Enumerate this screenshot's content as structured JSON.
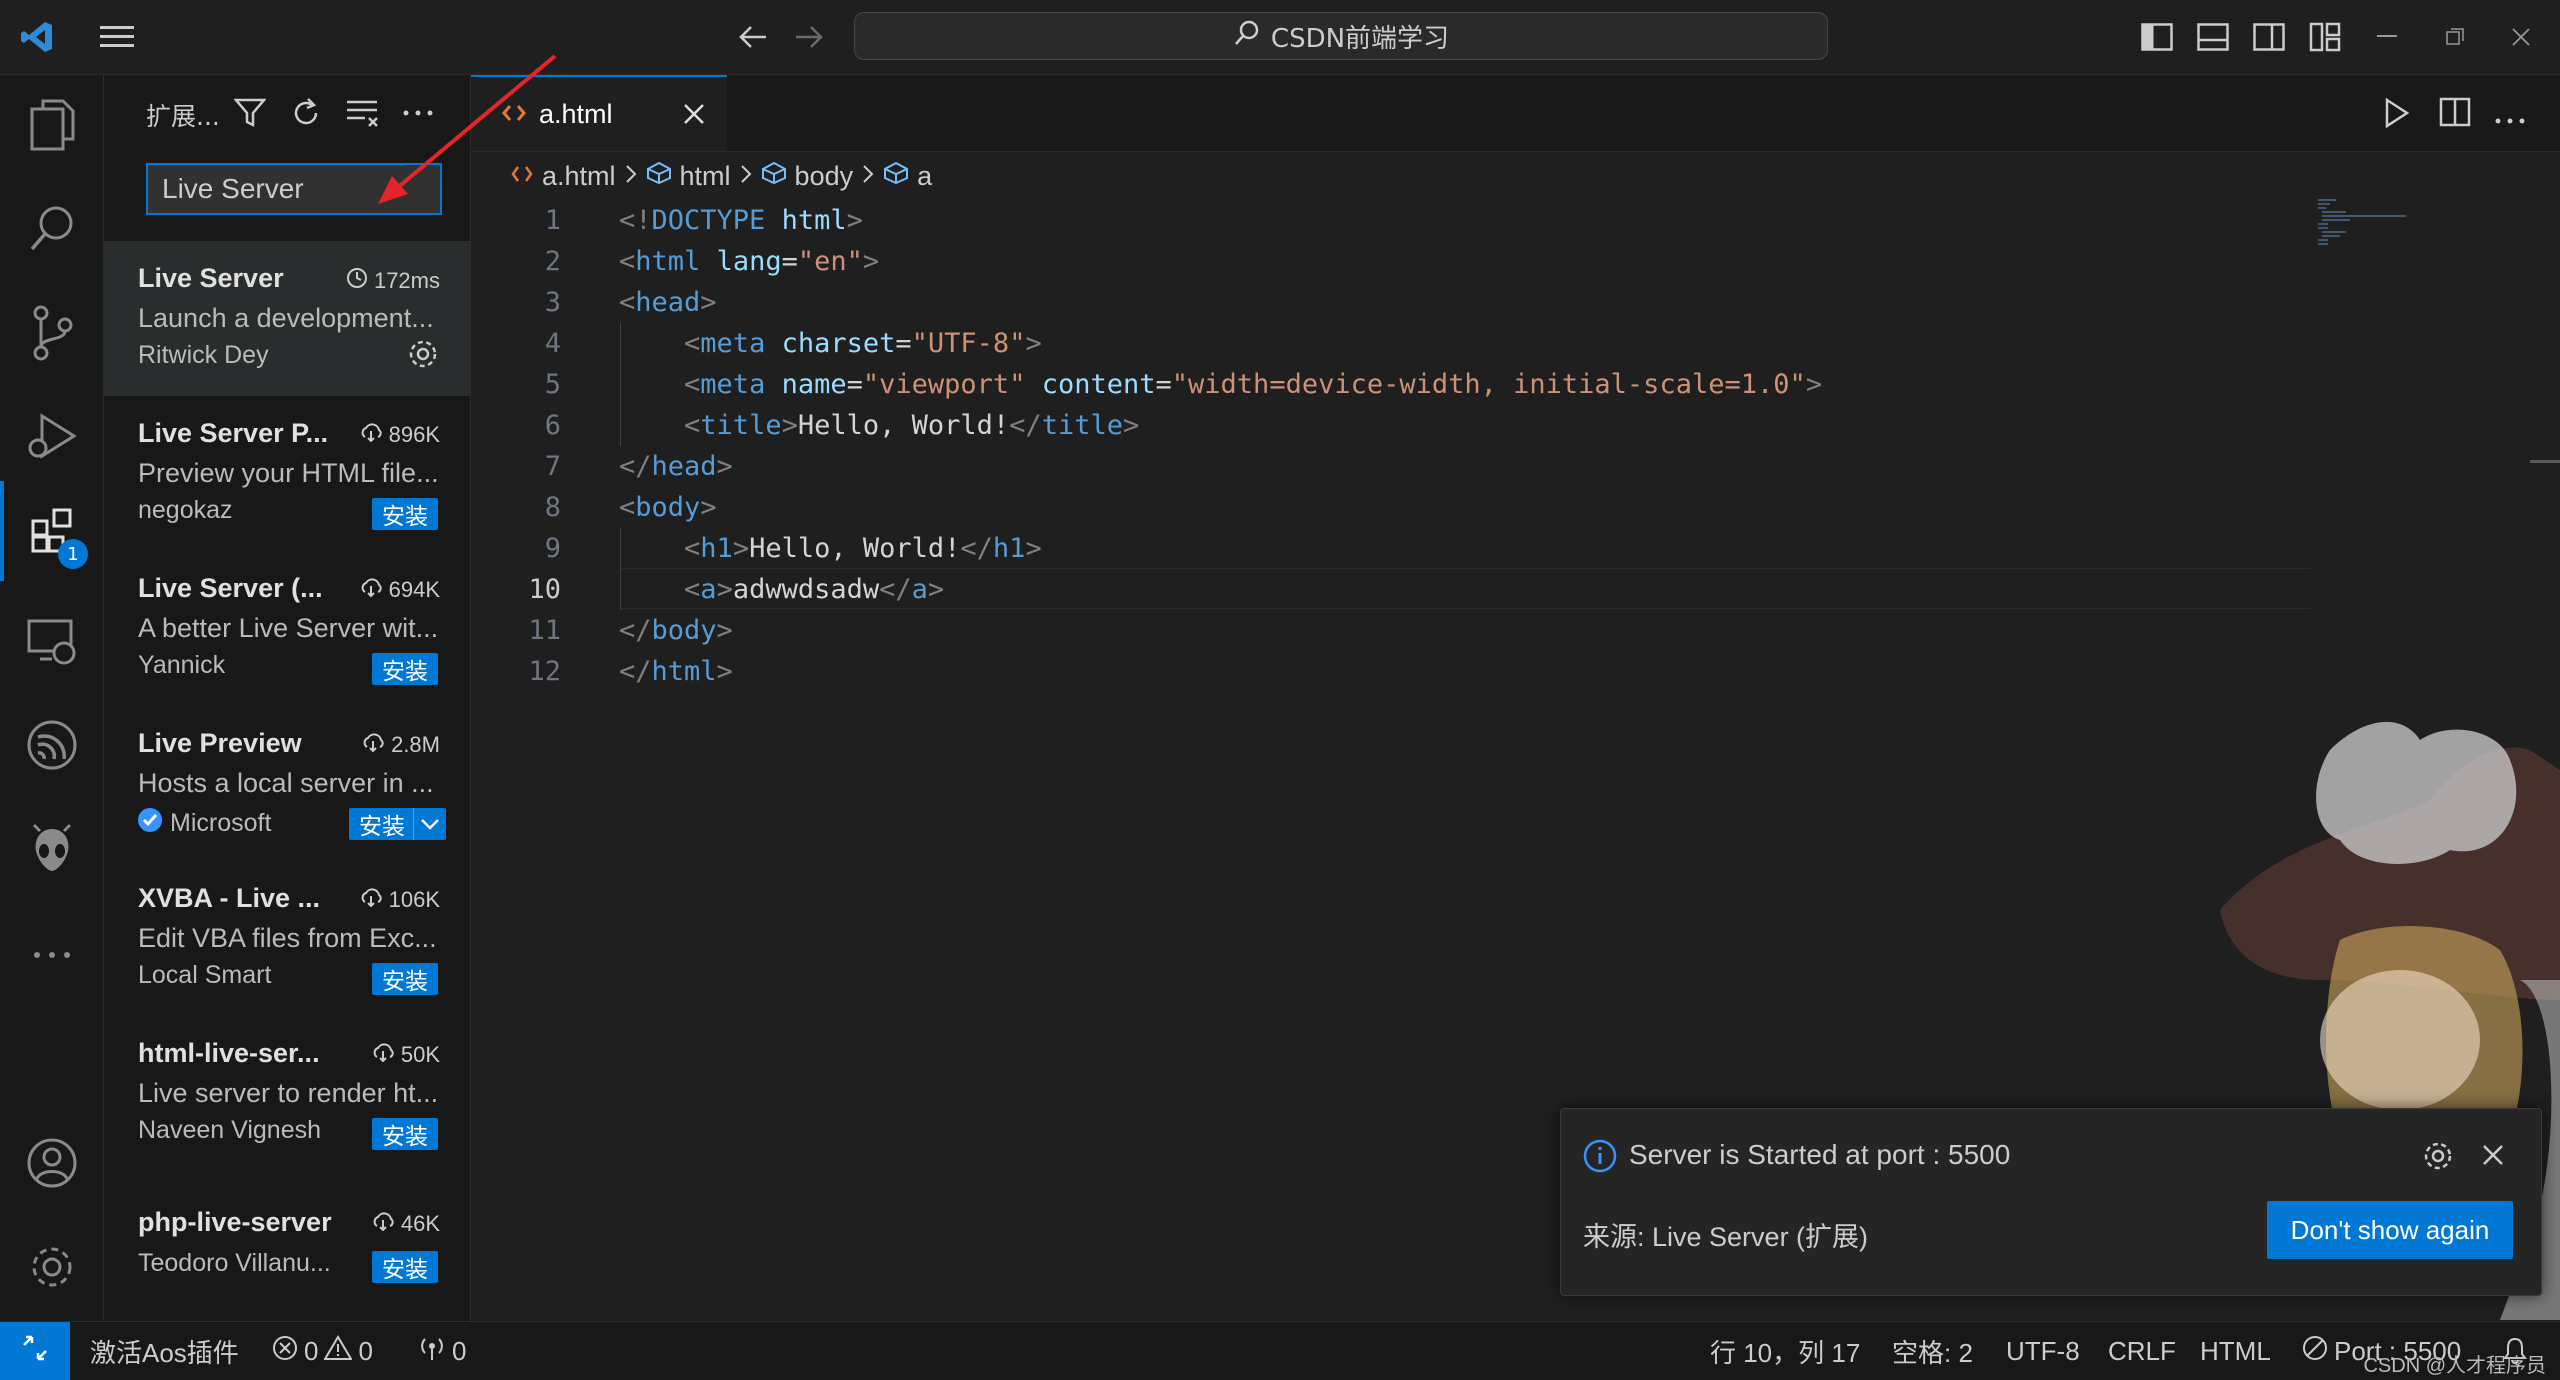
{
  "titlebar": {
    "search_text": "CSDN前端学习"
  },
  "sidebar": {
    "title": "扩展...",
    "search_value": "Live Server",
    "extensions": [
      {
        "name": "Live Server",
        "stat": "172ms",
        "stat_icon": "history-icon",
        "desc": "Launch a development...",
        "publisher": "Ritwick Dey",
        "action": "gear",
        "selected": true
      },
      {
        "name": "Live Server P...",
        "stat": "896K",
        "stat_icon": "cloud-download-icon",
        "desc": "Preview your HTML file...",
        "publisher": "negokaz",
        "action": "安装"
      },
      {
        "name": "Live Server (...",
        "stat": "694K",
        "stat_icon": "cloud-download-icon",
        "desc": "A better Live Server wit...",
        "publisher": "Yannick",
        "action": "安装"
      },
      {
        "name": "Live Preview",
        "stat": "2.8M",
        "stat_icon": "cloud-download-icon",
        "desc": "Hosts a local server in ...",
        "publisher": "Microsoft",
        "verified": true,
        "action": "安装"
      },
      {
        "name": "XVBA - Live ...",
        "stat": "106K",
        "stat_icon": "cloud-download-icon",
        "desc": "Edit VBA files from Exc...",
        "publisher": "Local Smart",
        "action": "安装"
      },
      {
        "name": "html-live-ser...",
        "stat": "50K",
        "stat_icon": "cloud-download-icon",
        "desc": "Live server to render ht...",
        "publisher": "Naveen Vignesh",
        "action": "安装"
      },
      {
        "name": "php-live-server",
        "stat": "46K",
        "stat_icon": "cloud-download-icon",
        "desc": "",
        "publisher": "Teodoro Villanu...",
        "action": "安装"
      }
    ]
  },
  "activity": {
    "extensions_badge": "1"
  },
  "editor": {
    "tab_label": "a.html",
    "breadcrumb": [
      "a.html",
      "html",
      "body",
      "a"
    ],
    "lines": [
      {
        "n": "1",
        "tokens": [
          [
            "t",
            "<!"
          ],
          [
            "tg",
            "DOCTYPE"
          ],
          [
            "tx",
            " "
          ],
          [
            "at",
            "html"
          ],
          [
            "t",
            ">"
          ]
        ]
      },
      {
        "n": "2",
        "tokens": [
          [
            "t",
            "<"
          ],
          [
            "tg",
            "html"
          ],
          [
            "tx",
            " "
          ],
          [
            "at",
            "lang"
          ],
          [
            "tx",
            "="
          ],
          [
            "st",
            "\"en\""
          ],
          [
            "t",
            ">"
          ]
        ]
      },
      {
        "n": "3",
        "tokens": [
          [
            "t",
            "<"
          ],
          [
            "tg",
            "head"
          ],
          [
            "t",
            ">"
          ]
        ]
      },
      {
        "n": "4",
        "tokens": [
          [
            "tx",
            "    "
          ],
          [
            "t",
            "<"
          ],
          [
            "tg",
            "meta"
          ],
          [
            "tx",
            " "
          ],
          [
            "at",
            "charset"
          ],
          [
            "tx",
            "="
          ],
          [
            "st",
            "\"UTF-8\""
          ],
          [
            "t",
            ">"
          ]
        ]
      },
      {
        "n": "5",
        "tokens": [
          [
            "tx",
            "    "
          ],
          [
            "t",
            "<"
          ],
          [
            "tg",
            "meta"
          ],
          [
            "tx",
            " "
          ],
          [
            "at",
            "name"
          ],
          [
            "tx",
            "="
          ],
          [
            "st",
            "\"viewport\""
          ],
          [
            "tx",
            " "
          ],
          [
            "at",
            "content"
          ],
          [
            "tx",
            "="
          ],
          [
            "st",
            "\"width=device-width, initial-scale=1.0\""
          ],
          [
            "t",
            ">"
          ]
        ]
      },
      {
        "n": "6",
        "tokens": [
          [
            "tx",
            "    "
          ],
          [
            "t",
            "<"
          ],
          [
            "tg",
            "title"
          ],
          [
            "t",
            ">"
          ],
          [
            "tx",
            "Hello, World!"
          ],
          [
            "t",
            "</"
          ],
          [
            "tg",
            "title"
          ],
          [
            "t",
            ">"
          ]
        ]
      },
      {
        "n": "7",
        "tokens": [
          [
            "t",
            "</"
          ],
          [
            "tg",
            "head"
          ],
          [
            "t",
            ">"
          ]
        ]
      },
      {
        "n": "8",
        "tokens": [
          [
            "t",
            "<"
          ],
          [
            "tg",
            "body"
          ],
          [
            "t",
            ">"
          ]
        ]
      },
      {
        "n": "9",
        "tokens": [
          [
            "tx",
            "    "
          ],
          [
            "t",
            "<"
          ],
          [
            "tg",
            "h1"
          ],
          [
            "t",
            ">"
          ],
          [
            "tx",
            "Hello, World!"
          ],
          [
            "t",
            "</"
          ],
          [
            "tg",
            "h1"
          ],
          [
            "t",
            ">"
          ]
        ]
      },
      {
        "n": "10",
        "tokens": [
          [
            "tx",
            "    "
          ],
          [
            "t",
            "<"
          ],
          [
            "tg",
            "a"
          ],
          [
            "t",
            ">"
          ],
          [
            "tx",
            "adwwdsadw"
          ],
          [
            "t",
            "</"
          ],
          [
            "tg",
            "a"
          ],
          [
            "t",
            ">"
          ]
        ]
      },
      {
        "n": "11",
        "tokens": [
          [
            "t",
            "</"
          ],
          [
            "tg",
            "body"
          ],
          [
            "t",
            ">"
          ]
        ]
      },
      {
        "n": "12",
        "tokens": [
          [
            "t",
            "</"
          ],
          [
            "tg",
            "html"
          ],
          [
            "t",
            ">"
          ]
        ]
      }
    ],
    "current_line": "10"
  },
  "notification": {
    "message": "Server is Started at port : 5500",
    "source": "来源: Live Server (扩展)",
    "button": "Don't show again"
  },
  "statusbar": {
    "activate_label": "激活Aos插件",
    "errors": "0",
    "warnings": "0",
    "ports_count": "0",
    "cursor": "行 10，列 17",
    "spaces": "空格: 2",
    "encoding": "UTF-8",
    "eol": "CRLF",
    "language": "HTML",
    "port": "Port : 5500",
    "watermark": "CSDN @人才程序员"
  }
}
